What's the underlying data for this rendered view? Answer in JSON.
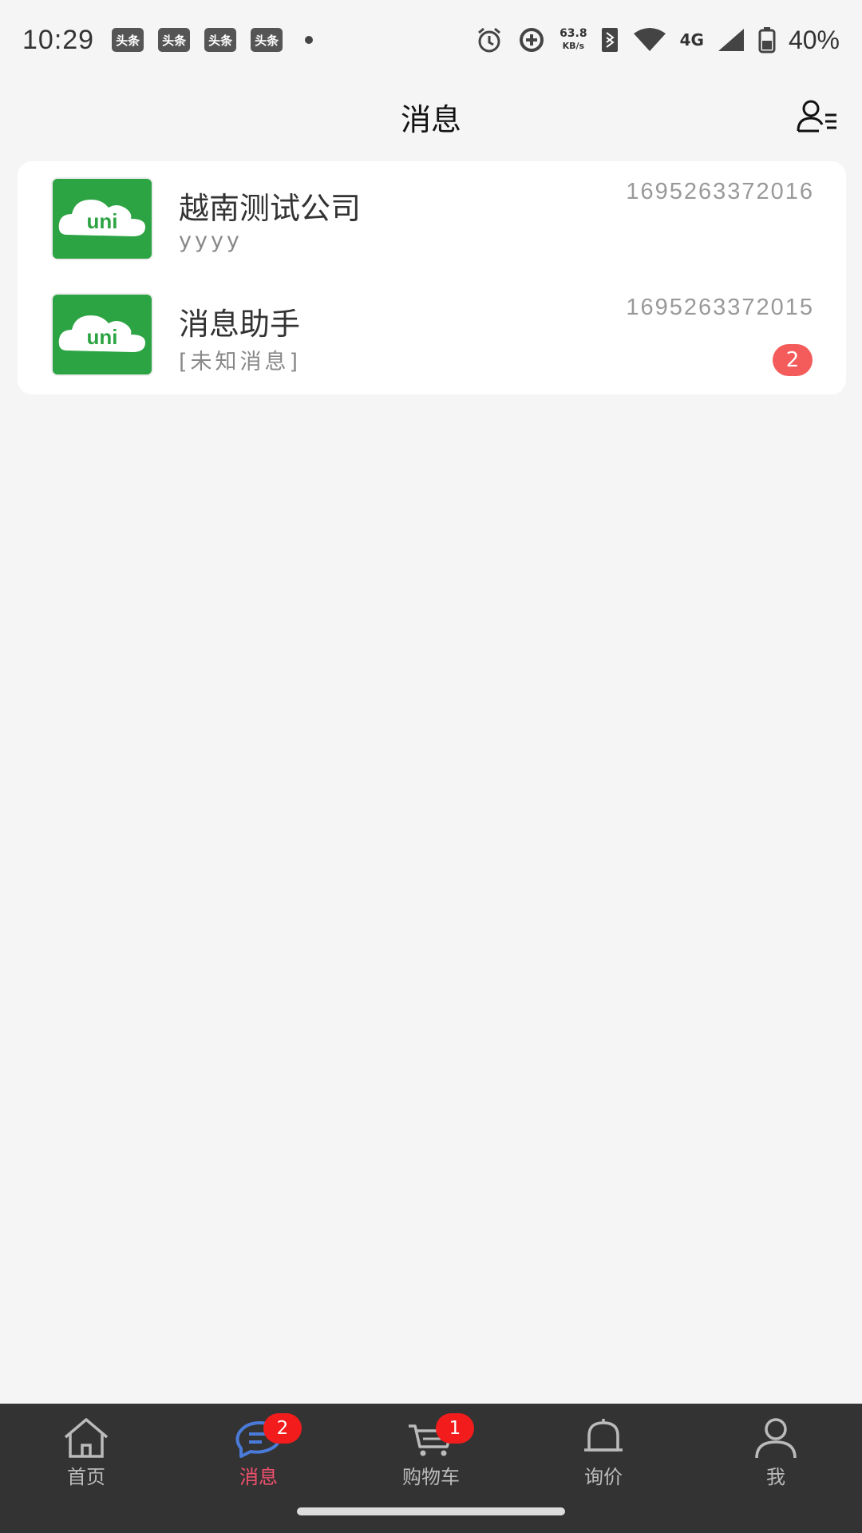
{
  "status_bar": {
    "time": "10:29",
    "app_icons": [
      "头条",
      "头条",
      "头条",
      "头条"
    ],
    "speed_value": "63.8",
    "speed_unit": "KB/s",
    "network": "4G",
    "battery": "40%"
  },
  "header": {
    "title": "消息",
    "contacts_icon": "contacts-list-icon"
  },
  "conversations": [
    {
      "name": "越南测试公司",
      "preview": "yyyy",
      "time": "1695263372016",
      "unread": "",
      "avatar_text": "uni"
    },
    {
      "name": "消息助手",
      "preview": "[未知消息]",
      "time": "1695263372015",
      "unread": "2",
      "avatar_text": "uni"
    }
  ],
  "tabbar": {
    "tabs": [
      {
        "label": "首页",
        "icon": "home-icon",
        "badge": ""
      },
      {
        "label": "消息",
        "icon": "message-icon",
        "badge": "2"
      },
      {
        "label": "购物车",
        "icon": "cart-icon",
        "badge": "1"
      },
      {
        "label": "询价",
        "icon": "bell-icon",
        "badge": ""
      },
      {
        "label": "我",
        "icon": "profile-icon",
        "badge": ""
      }
    ],
    "active_index": 1
  },
  "colors": {
    "accent": "#f0506e",
    "badge": "#f21c1c",
    "avatar_green": "#2ca443",
    "tabbar_bg": "#333333"
  }
}
